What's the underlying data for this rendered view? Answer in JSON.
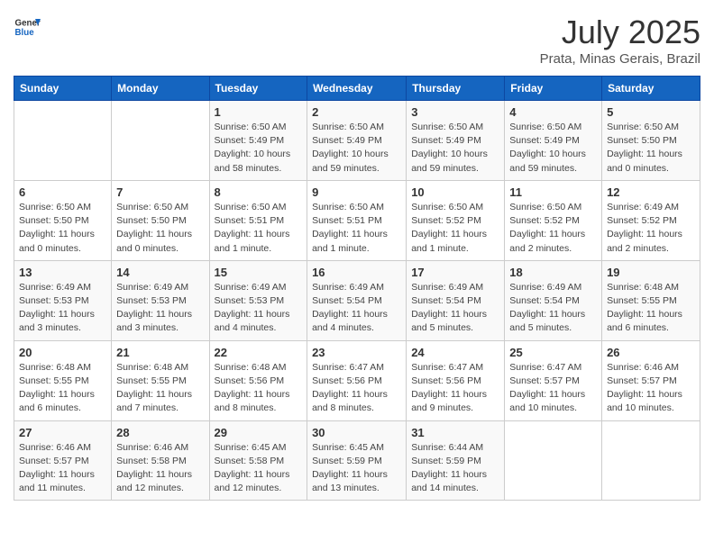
{
  "logo": {
    "line1": "General",
    "line2": "Blue"
  },
  "title": "July 2025",
  "location": "Prata, Minas Gerais, Brazil",
  "headers": [
    "Sunday",
    "Monday",
    "Tuesday",
    "Wednesday",
    "Thursday",
    "Friday",
    "Saturday"
  ],
  "weeks": [
    [
      {
        "day": "",
        "detail": ""
      },
      {
        "day": "",
        "detail": ""
      },
      {
        "day": "1",
        "detail": "Sunrise: 6:50 AM\nSunset: 5:49 PM\nDaylight: 10 hours\nand 58 minutes."
      },
      {
        "day": "2",
        "detail": "Sunrise: 6:50 AM\nSunset: 5:49 PM\nDaylight: 10 hours\nand 59 minutes."
      },
      {
        "day": "3",
        "detail": "Sunrise: 6:50 AM\nSunset: 5:49 PM\nDaylight: 10 hours\nand 59 minutes."
      },
      {
        "day": "4",
        "detail": "Sunrise: 6:50 AM\nSunset: 5:49 PM\nDaylight: 10 hours\nand 59 minutes."
      },
      {
        "day": "5",
        "detail": "Sunrise: 6:50 AM\nSunset: 5:50 PM\nDaylight: 11 hours\nand 0 minutes."
      }
    ],
    [
      {
        "day": "6",
        "detail": "Sunrise: 6:50 AM\nSunset: 5:50 PM\nDaylight: 11 hours\nand 0 minutes."
      },
      {
        "day": "7",
        "detail": "Sunrise: 6:50 AM\nSunset: 5:50 PM\nDaylight: 11 hours\nand 0 minutes."
      },
      {
        "day": "8",
        "detail": "Sunrise: 6:50 AM\nSunset: 5:51 PM\nDaylight: 11 hours\nand 1 minute."
      },
      {
        "day": "9",
        "detail": "Sunrise: 6:50 AM\nSunset: 5:51 PM\nDaylight: 11 hours\nand 1 minute."
      },
      {
        "day": "10",
        "detail": "Sunrise: 6:50 AM\nSunset: 5:52 PM\nDaylight: 11 hours\nand 1 minute."
      },
      {
        "day": "11",
        "detail": "Sunrise: 6:50 AM\nSunset: 5:52 PM\nDaylight: 11 hours\nand 2 minutes."
      },
      {
        "day": "12",
        "detail": "Sunrise: 6:49 AM\nSunset: 5:52 PM\nDaylight: 11 hours\nand 2 minutes."
      }
    ],
    [
      {
        "day": "13",
        "detail": "Sunrise: 6:49 AM\nSunset: 5:53 PM\nDaylight: 11 hours\nand 3 minutes."
      },
      {
        "day": "14",
        "detail": "Sunrise: 6:49 AM\nSunset: 5:53 PM\nDaylight: 11 hours\nand 3 minutes."
      },
      {
        "day": "15",
        "detail": "Sunrise: 6:49 AM\nSunset: 5:53 PM\nDaylight: 11 hours\nand 4 minutes."
      },
      {
        "day": "16",
        "detail": "Sunrise: 6:49 AM\nSunset: 5:54 PM\nDaylight: 11 hours\nand 4 minutes."
      },
      {
        "day": "17",
        "detail": "Sunrise: 6:49 AM\nSunset: 5:54 PM\nDaylight: 11 hours\nand 5 minutes."
      },
      {
        "day": "18",
        "detail": "Sunrise: 6:49 AM\nSunset: 5:54 PM\nDaylight: 11 hours\nand 5 minutes."
      },
      {
        "day": "19",
        "detail": "Sunrise: 6:48 AM\nSunset: 5:55 PM\nDaylight: 11 hours\nand 6 minutes."
      }
    ],
    [
      {
        "day": "20",
        "detail": "Sunrise: 6:48 AM\nSunset: 5:55 PM\nDaylight: 11 hours\nand 6 minutes."
      },
      {
        "day": "21",
        "detail": "Sunrise: 6:48 AM\nSunset: 5:55 PM\nDaylight: 11 hours\nand 7 minutes."
      },
      {
        "day": "22",
        "detail": "Sunrise: 6:48 AM\nSunset: 5:56 PM\nDaylight: 11 hours\nand 8 minutes."
      },
      {
        "day": "23",
        "detail": "Sunrise: 6:47 AM\nSunset: 5:56 PM\nDaylight: 11 hours\nand 8 minutes."
      },
      {
        "day": "24",
        "detail": "Sunrise: 6:47 AM\nSunset: 5:56 PM\nDaylight: 11 hours\nand 9 minutes."
      },
      {
        "day": "25",
        "detail": "Sunrise: 6:47 AM\nSunset: 5:57 PM\nDaylight: 11 hours\nand 10 minutes."
      },
      {
        "day": "26",
        "detail": "Sunrise: 6:46 AM\nSunset: 5:57 PM\nDaylight: 11 hours\nand 10 minutes."
      }
    ],
    [
      {
        "day": "27",
        "detail": "Sunrise: 6:46 AM\nSunset: 5:57 PM\nDaylight: 11 hours\nand 11 minutes."
      },
      {
        "day": "28",
        "detail": "Sunrise: 6:46 AM\nSunset: 5:58 PM\nDaylight: 11 hours\nand 12 minutes."
      },
      {
        "day": "29",
        "detail": "Sunrise: 6:45 AM\nSunset: 5:58 PM\nDaylight: 11 hours\nand 12 minutes."
      },
      {
        "day": "30",
        "detail": "Sunrise: 6:45 AM\nSunset: 5:59 PM\nDaylight: 11 hours\nand 13 minutes."
      },
      {
        "day": "31",
        "detail": "Sunrise: 6:44 AM\nSunset: 5:59 PM\nDaylight: 11 hours\nand 14 minutes."
      },
      {
        "day": "",
        "detail": ""
      },
      {
        "day": "",
        "detail": ""
      }
    ]
  ]
}
